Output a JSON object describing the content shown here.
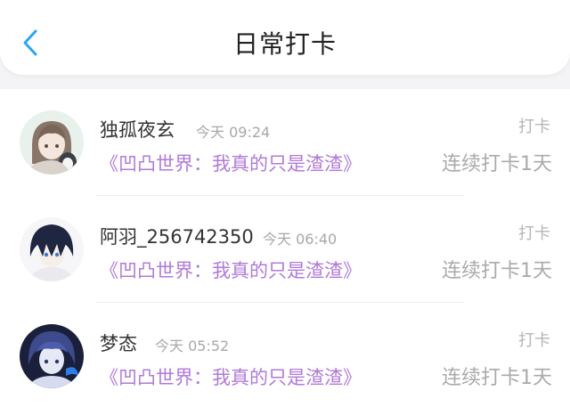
{
  "header": {
    "title": "日常打卡",
    "back_icon": "chevron-left-icon"
  },
  "accent": "#2aa6f5",
  "book_color": "#b07ad8",
  "entries": [
    {
      "name": "独孤夜玄",
      "time": "今天 09:24",
      "book": "《凹凸世界：我真的只是渣渣》",
      "tag": "打卡",
      "streak": "连续打卡1天"
    },
    {
      "name": "阿羽_256742350",
      "time": "今天 06:40",
      "book": "《凹凸世界：我真的只是渣渣》",
      "tag": "打卡",
      "streak": "连续打卡1天"
    },
    {
      "name": "梦态",
      "time": "今天 05:52",
      "book": "《凹凸世界：我真的只是渣渣》",
      "tag": "打卡",
      "streak": "连续打卡1天"
    }
  ]
}
